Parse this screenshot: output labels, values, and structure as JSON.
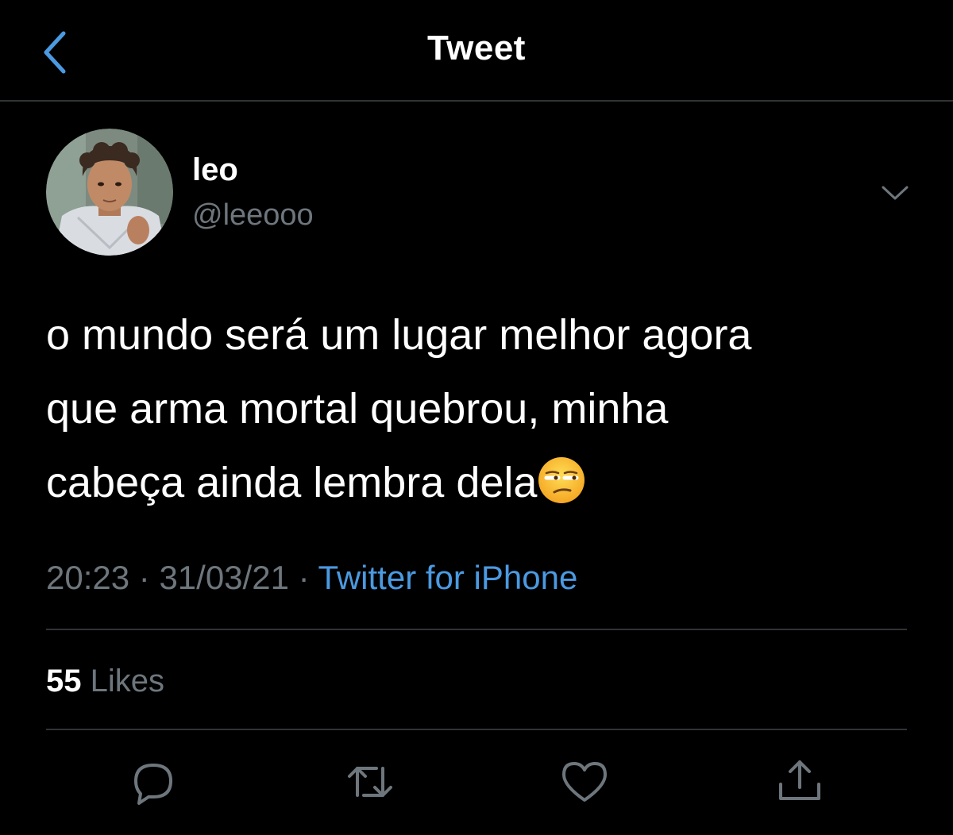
{
  "header": {
    "title": "Tweet",
    "back_icon": "chevron-left-icon"
  },
  "author": {
    "display_name": "leo",
    "handle": "@leeooo",
    "menu_icon": "chevron-down-icon"
  },
  "tweet": {
    "lines": [
      "o mundo será um lugar melhor agora",
      "que arma mortal quebrou, minha",
      "cabeça ainda lembra dela"
    ],
    "emoji": "unamused-face-emoji"
  },
  "meta": {
    "time": "20:23",
    "separator": " · ",
    "date": "31/03/21",
    "source": "Twitter for iPhone"
  },
  "stats": {
    "likes_count": "55",
    "likes_label": " Likes"
  },
  "actions": [
    {
      "name": "reply",
      "icon": "reply-icon"
    },
    {
      "name": "retweet",
      "icon": "retweet-icon"
    },
    {
      "name": "like",
      "icon": "heart-icon"
    },
    {
      "name": "share",
      "icon": "share-icon"
    }
  ],
  "colors": {
    "background": "#000000",
    "primary_text": "#ffffff",
    "secondary_text": "#6e767d",
    "accent": "#4b99e1",
    "divider": "#2f3336"
  }
}
